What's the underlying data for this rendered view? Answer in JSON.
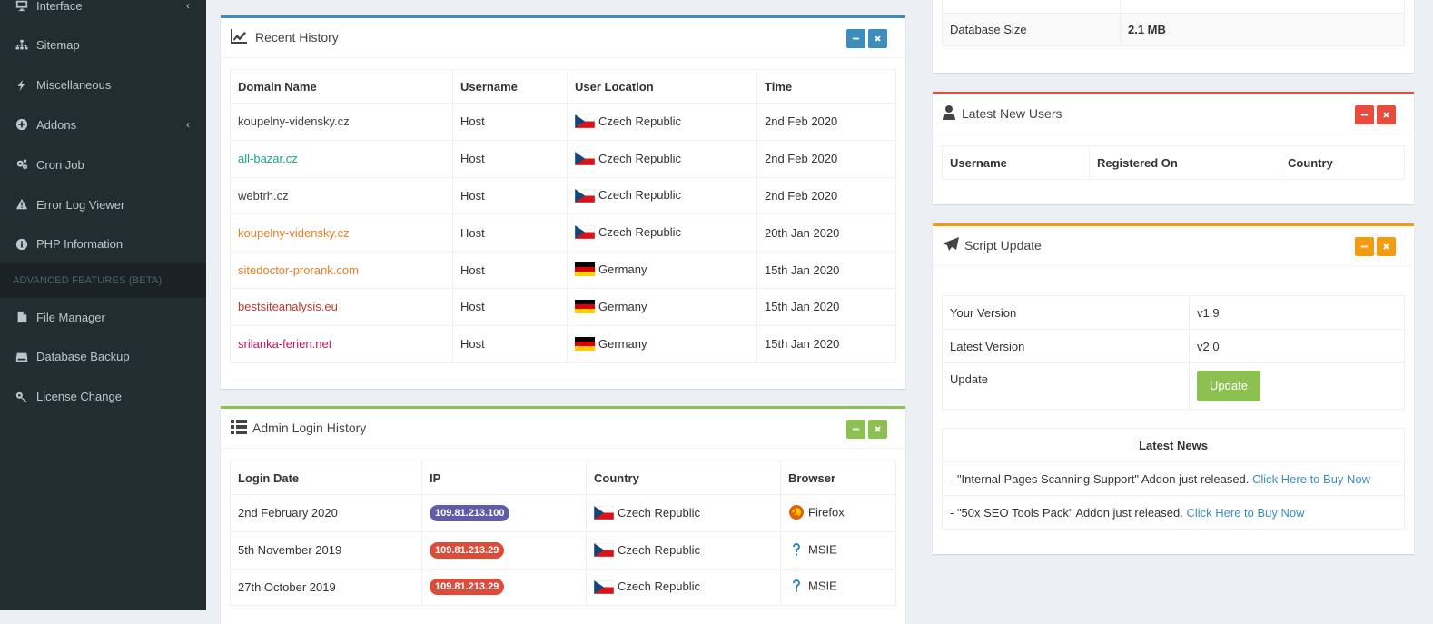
{
  "colors": {
    "sidebar_bg": "#222d32",
    "sidebar_text": "#b8c7ce",
    "primary": "#3c8dbc",
    "success": "#8cc152",
    "danger": "#e74c3c",
    "warning": "#f39c12",
    "link": "#3c8dbc"
  },
  "sidebar": {
    "items_top": [
      {
        "label": "Interface",
        "icon": "monitor-icon",
        "chevron": "‹"
      },
      {
        "label": "Sitemap",
        "icon": "sitemap-icon"
      },
      {
        "label": "Miscellaneous",
        "icon": "bolt-icon"
      },
      {
        "label": "Addons",
        "icon": "plus-circle-icon",
        "chevron": "‹"
      },
      {
        "label": "Cron Job",
        "icon": "gears-icon"
      },
      {
        "label": "Error Log Viewer",
        "icon": "warning-icon"
      },
      {
        "label": "PHP Information",
        "icon": "info-icon"
      }
    ],
    "section_header": "ADVANCED FEATURES (BETA)",
    "items_bottom": [
      {
        "label": "File Manager",
        "icon": "file-icon"
      },
      {
        "label": "Database Backup",
        "icon": "hdd-icon"
      },
      {
        "label": "License Change",
        "icon": "key-icon"
      }
    ]
  },
  "recent_history": {
    "title": "Recent History",
    "columns": [
      "Domain Name",
      "Username",
      "User Location",
      "Time"
    ],
    "rows": [
      {
        "domain": "koupelny-vidensky.cz",
        "domain_color": "#444444",
        "username": "Host",
        "flag": "cz",
        "location": "Czech Republic",
        "time": "2nd Feb 2020"
      },
      {
        "domain": "all-bazar.cz",
        "domain_color": "#17a589",
        "username": "Host",
        "flag": "cz",
        "location": "Czech Republic",
        "time": "2nd Feb 2020"
      },
      {
        "domain": "webtrh.cz",
        "domain_color": "#444444",
        "username": "Host",
        "flag": "cz",
        "location": "Czech Republic",
        "time": "2nd Feb 2020"
      },
      {
        "domain": "koupelny-vidensky.cz",
        "domain_color": "#e67e22",
        "username": "Host",
        "flag": "cz",
        "location": "Czech Republic",
        "time": "20th Jan 2020"
      },
      {
        "domain": "sitedoctor-prorank.com",
        "domain_color": "#e67e22",
        "username": "Host",
        "flag": "de",
        "location": "Germany",
        "time": "15th Jan 2020"
      },
      {
        "domain": "bestsiteanalysis.eu",
        "domain_color": "#c0392b",
        "username": "Host",
        "flag": "de",
        "location": "Germany",
        "time": "15th Jan 2020"
      },
      {
        "domain": "srilanka-ferien.net",
        "domain_color": "#c2185b",
        "username": "Host",
        "flag": "de",
        "location": "Germany",
        "time": "15th Jan 2020"
      }
    ]
  },
  "admin_login_history": {
    "title": "Admin Login History",
    "columns": [
      "Login Date",
      "IP",
      "Country",
      "Browser"
    ],
    "rows": [
      {
        "date": "2nd February 2020",
        "ip": "109.81.213.100",
        "ip_color": "#605ca8",
        "flag": "cz",
        "country": "Czech Republic",
        "browser": "Firefox",
        "browser_icon": "firefox-icon"
      },
      {
        "date": "5th November 2019",
        "ip": "109.81.213.29",
        "ip_color": "#dd4b39",
        "flag": "cz",
        "country": "Czech Republic",
        "browser": "MSIE",
        "browser_icon": "question-icon"
      },
      {
        "date": "27th October 2019",
        "ip": "109.81.213.29",
        "ip_color": "#dd4b39",
        "flag": "cz",
        "country": "Czech Republic",
        "browser": "MSIE",
        "browser_icon": "question-icon"
      }
    ]
  },
  "stats": {
    "label": "Database Size",
    "value": "2.1 MB"
  },
  "latest_users": {
    "title": "Latest New Users",
    "columns": [
      "Username",
      "Registered On",
      "Country"
    ]
  },
  "script_update": {
    "title": "Script Update",
    "your_version_label": "Your Version",
    "your_version": "v1.9",
    "latest_version_label": "Latest Version",
    "latest_version": "v2.0",
    "update_label": "Update",
    "update_button": "Update",
    "news_header": "Latest News",
    "news": [
      {
        "text": "- \"Internal Pages Scanning Support\" Addon just released. ",
        "link": "Click Here to Buy Now"
      },
      {
        "text": "- \"50x SEO Tools Pack\" Addon just released. ",
        "link": "Click Here to Buy Now"
      }
    ]
  }
}
